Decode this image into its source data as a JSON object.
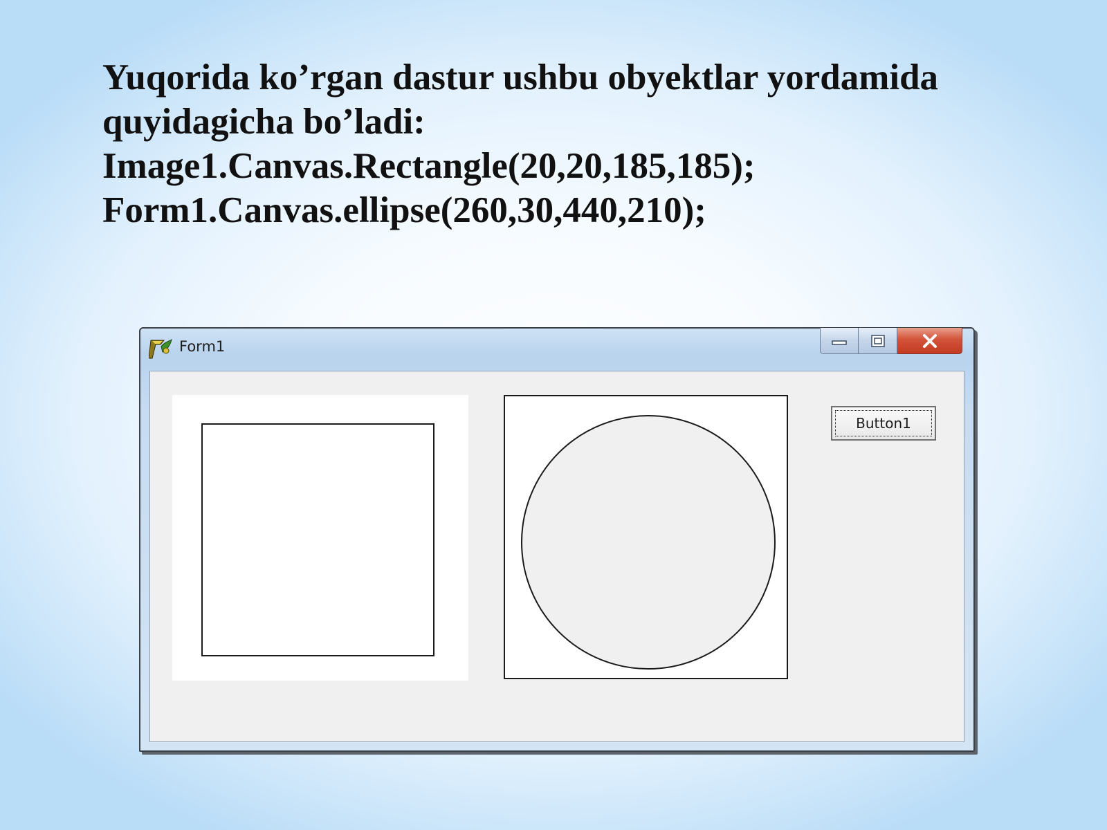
{
  "slide": {
    "lines": [
      "Yuqorida ko’rgan dastur ushbu obyektlar yordamida",
      "quyidagicha bo’ladi:",
      "Image1.Canvas.Rectangle(20,20,185,185);",
      "Form1.Canvas.ellipse(260,30,440,210);"
    ]
  },
  "window": {
    "title": "Form1",
    "icon": "delphi-app-icon",
    "caption_buttons": [
      "minimize-icon",
      "maximize-icon",
      "close-icon"
    ]
  },
  "form": {
    "button1_label": "Button1"
  },
  "colors": {
    "background_edge": "#b9dcf7",
    "client_area": "#f0f0f0",
    "close_button": "#c33a22"
  }
}
